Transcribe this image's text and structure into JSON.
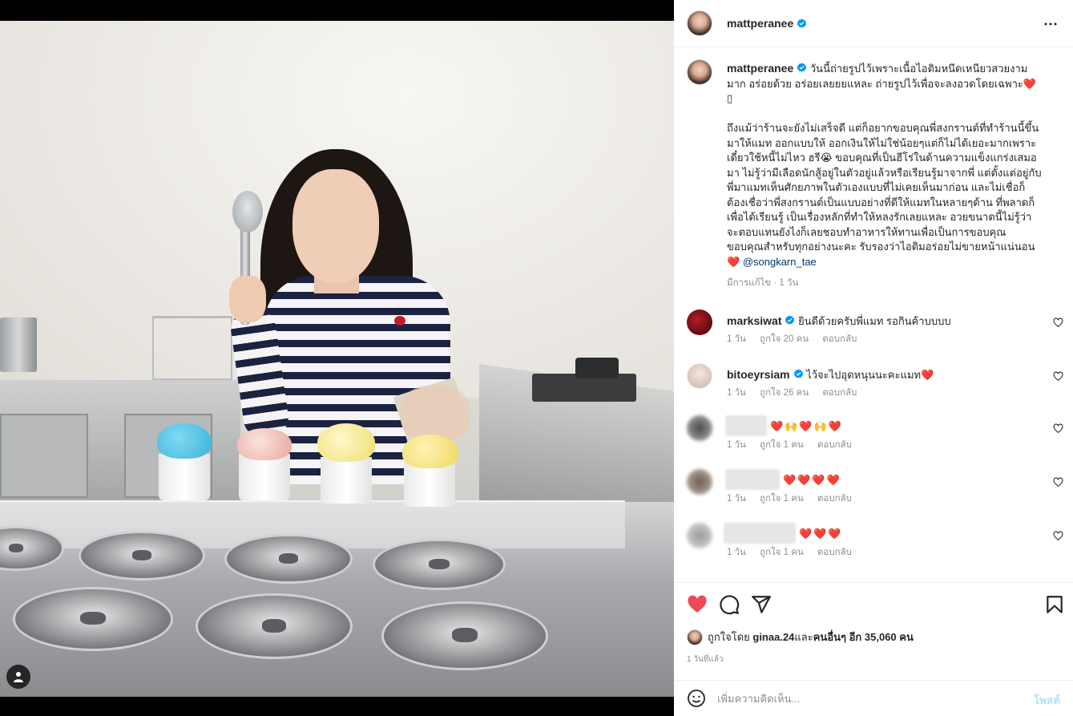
{
  "post": {
    "author": "mattperanee",
    "more_icon": "more-horizontal-icon",
    "verified_icon": "verified-badge-icon"
  },
  "caption": {
    "username": "mattperanee",
    "lines": [
      " วันนี้ถ่ายรูปไว้เพราะเนื้อไอติมหนึดเหนียวสวยงาม",
      "มาก อร่อยด้วย อร่อยเลยยยแหละ ถ่ายรูปไว้เพื่อจะลงอวดโดยเฉพาะ❤️",
      "▯",
      "",
      "ถึงแม้ว่าร้านจะยังไม่เสร็จดี แต่ก็อยากขอบคุณพี่สงกรานต์ที่ทำร้านนี้ขึ้น",
      "มาให้แมท ออกแบบให้ ออกเงินให้ไม่ใช่น้อยๆแต่ก็ไม่ได้เยอะมากเพราะ",
      "เดี๋ยวใช้หนี้ไม่ไหว ฮรี😭 ขอบคุณที่เป็นฮีโร่ในด้านความแข็งแกร่งเสมอ",
      "มา ไม่รู้ว่ามีเลือดนักสู้อยู่ในตัวอยู่แล้วหรือเรียนรู้มาจากพี่ แต่ตั้งแต่อยู่กับ",
      "พี่มาแมทเห็นศักยภาพในตัวเองแบบที่ไม่เคยเห็นมาก่อน และไม่เชื่อก็",
      "ต้องเชื่อว่าพี่สงกรานต์เป็นแบบอย่างที่ดีให้แมทในหลายๆด้าน ที่พลาดก็",
      "เพื่อได้เรียนรู้ เป็นเรื่องหลักที่ทำให้หลงรักเลยแหละ อวยขนาดนี้ไม่รู้ว่า",
      "จะตอบแทนยังไงก็เลยชอบทำอาหารให้ทานเพื่อเป็นการขอบคุณ",
      "ขอบคุณสำหรับทุกอย่างนะคะ รับรองว่าไอติมอร่อยไม่ขายหน้าแน่นอน"
    ],
    "last_line_heart": "❤️",
    "mention": "@songkarn_tae",
    "edited": "มีการแก้ไข · 1 วัน"
  },
  "comments": [
    {
      "username": "marksiwat",
      "verified": true,
      "text": " ยินดีด้วยครับพี่แมท รอกินค้าบบบบ",
      "time": "1 วัน",
      "likes": "ถูกใจ 20 คน",
      "reply": "ตอบกลับ",
      "avatar_color": "#5a0b0e"
    },
    {
      "username": "bitoeyrsiam",
      "verified": true,
      "text": " ไว้จะไปอุดหนุนนะคะแมท❤️",
      "time": "1 วัน",
      "likes": "ถูกใจ 26 คน",
      "reply": "ตอบกลับ",
      "avatar_color": "#e9dcd4"
    },
    {
      "username": "",
      "verified": false,
      "text": "❤️🙌❤️🙌❤️",
      "time": "1 วัน",
      "likes": "ถูกใจ 1 คน",
      "reply": "ตอบกลับ",
      "avatar_color": "#6d6a6c"
    },
    {
      "username": "",
      "verified": false,
      "text": "❤️❤️❤️❤️",
      "time": "1 วัน",
      "likes": "ถูกใจ 1 คน",
      "reply": "ตอบกลับ",
      "avatar_color": "#8a7a6c"
    },
    {
      "username": "",
      "verified": false,
      "text": "❤️❤️❤️",
      "time": "1 วัน",
      "likes": "ถูกใจ 1 คน",
      "reply": "ตอบกลับ",
      "avatar_color": "#a9aaac"
    }
  ],
  "actions": {
    "like_icon": "heart-filled-icon",
    "comment_icon": "comment-bubble-icon",
    "share_icon": "paper-plane-icon",
    "save_icon": "bookmark-icon",
    "like_color": "#ed4956"
  },
  "likes": {
    "prefix": "ถูกใจโดย ",
    "user": "ginaa.24",
    "middle": " และ",
    "others": "คนอื่นๆ อีก 35,060 คน"
  },
  "timestamp": "1 วันที่แล้ว",
  "add_comment": {
    "placeholder": "เพิ่มความคิดเห็น...",
    "post_label": "โพสต์",
    "emoji_icon": "emoji-smile-icon"
  },
  "colors": {
    "verified": "#0095f6",
    "post_button_disabled": "#b2dffc",
    "mention": "#00376b"
  }
}
